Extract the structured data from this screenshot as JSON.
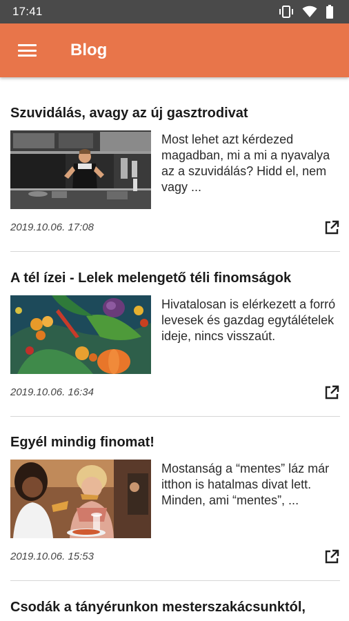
{
  "status_bar": {
    "time": "17:41",
    "icons": [
      "vibrate-icon",
      "wifi-icon",
      "battery-icon"
    ]
  },
  "app_bar": {
    "menu_icon": "hamburger-menu-icon",
    "title": "Blog"
  },
  "colors": {
    "status_bar": "#4a4a4a",
    "app_bar": "#e8754a",
    "divider": "#d6d6d6"
  },
  "posts": [
    {
      "title": "Szuvidálás, avagy az új gasztrodivat",
      "excerpt": "Most lehet azt kérdezed magadban, mi a mi a nyavalya az a szuvidálás? Hidd el, nem vagy ...",
      "date": "2019.10.06. 17:08",
      "image": "chef-kitchen-photo",
      "action_icon": "open-external-icon"
    },
    {
      "title": "A tél ízei - Lelek melengető téli finomságok",
      "excerpt": "Hivatalosan is elérkezett a forró levesek és gazdag egytálételek ideje, nincs visszaút.",
      "date": "2019.10.06. 16:34",
      "image": "winter-vegetables-photo",
      "action_icon": "open-external-icon"
    },
    {
      "title": "Egyél mindig finomat!",
      "excerpt": "Mostanság a “mentes” láz már itthon is hatalmas divat lett. Minden, ami “mentes”, ...",
      "date": "2019.10.06. 15:53",
      "image": "women-eating-pizza-photo",
      "action_icon": "open-external-icon"
    },
    {
      "title": "Csodák a tányérunkon mesterszakácsunktól,"
    }
  ]
}
